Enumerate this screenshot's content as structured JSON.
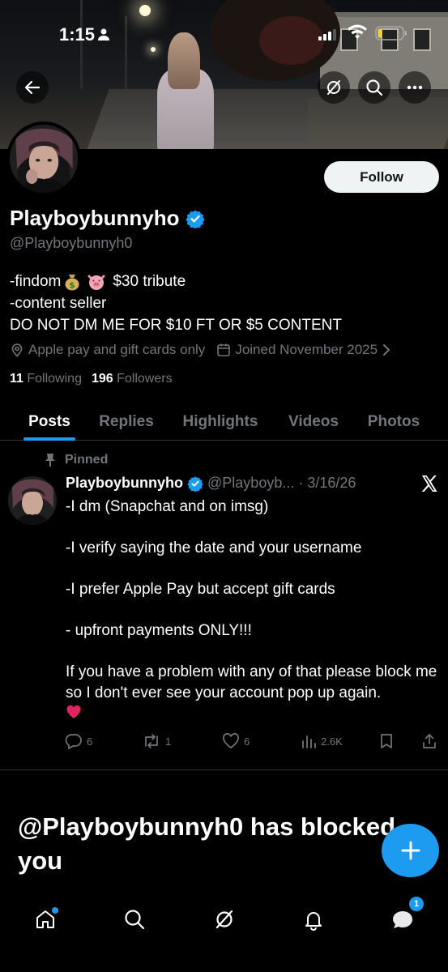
{
  "status_bar": {
    "time": "1:15"
  },
  "profile": {
    "display_name": "Playboybunnyho",
    "handle": "@Playboybunnyh0",
    "follow_label": "Follow",
    "bio": {
      "line1_prefix": "-findom",
      "line1_suffix": "$30 tribute",
      "line2": "-content seller",
      "line3": "DO NOT DM ME FOR $10 FT OR $5 CONTENT"
    },
    "location": "Apple pay and gift cards only",
    "joined": "Joined November 2025",
    "following_count": "11",
    "following_label": "Following",
    "followers_count": "196",
    "followers_label": "Followers"
  },
  "tabs": [
    {
      "label": "Posts"
    },
    {
      "label": "Replies"
    },
    {
      "label": "Highlights"
    },
    {
      "label": "Videos"
    },
    {
      "label": "Photos"
    }
  ],
  "post": {
    "pinned_label": "Pinned",
    "author_name": "Playboybunnyho",
    "author_handle": "@Playboyb...",
    "date": "· 3/16/26",
    "paragraphs": [
      "-I dm (Snapchat and on imsg)",
      "-I verify saying the date and your username",
      "-I prefer Apple Pay but accept gift cards",
      "- upfront payments ONLY!!!",
      "If you have a problem with any of that please block me so I don't ever see your account pop up again."
    ],
    "replies": "6",
    "reposts": "1",
    "likes": "6",
    "views": "2.6K"
  },
  "blocked_message": "@Playboybunnyh0 has blocked you",
  "nav": {
    "messages_badge": "1"
  },
  "colors": {
    "accent": "#1d9bf0",
    "muted": "#71767b",
    "background": "#000000"
  },
  "icons": [
    "back-arrow-icon",
    "grok-icon",
    "search-icon",
    "more-icon",
    "verified-icon",
    "location-icon",
    "calendar-icon",
    "chevron-right-icon",
    "pin-icon",
    "x-logo-icon",
    "reply-icon",
    "repost-icon",
    "like-icon",
    "views-icon",
    "bookmark-icon",
    "share-icon",
    "compose-icon",
    "home-icon",
    "notifications-icon",
    "messages-icon"
  ]
}
